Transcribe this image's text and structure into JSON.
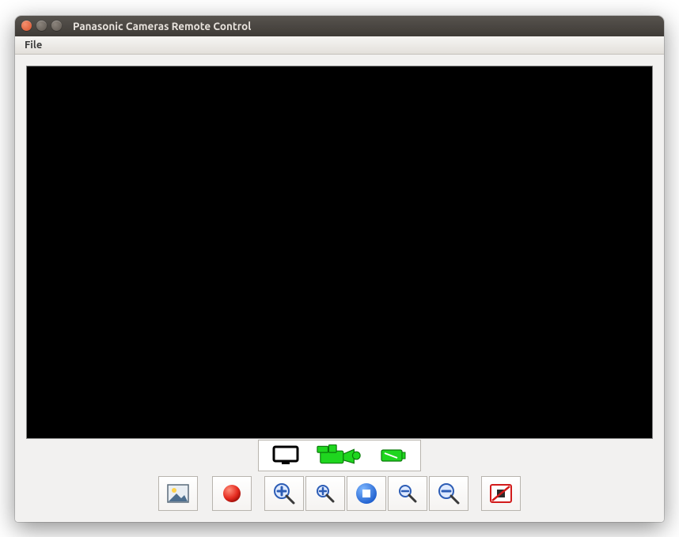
{
  "window": {
    "title": "Panasonic Cameras Remote Control"
  },
  "menu": {
    "file": "File"
  },
  "modes": {
    "display": "display-mode",
    "camcorder": "camcorder-mode",
    "playback": "playback-mode"
  },
  "toolbar": {
    "snapshot": "snapshot",
    "record": "record",
    "zoom_in": "zoom-in",
    "zoom_in_step": "zoom-in-step",
    "zoom_fit": "zoom-fit",
    "zoom_out_step": "zoom-out-step",
    "zoom_out": "zoom-out",
    "stop_capture": "stop-capture"
  }
}
